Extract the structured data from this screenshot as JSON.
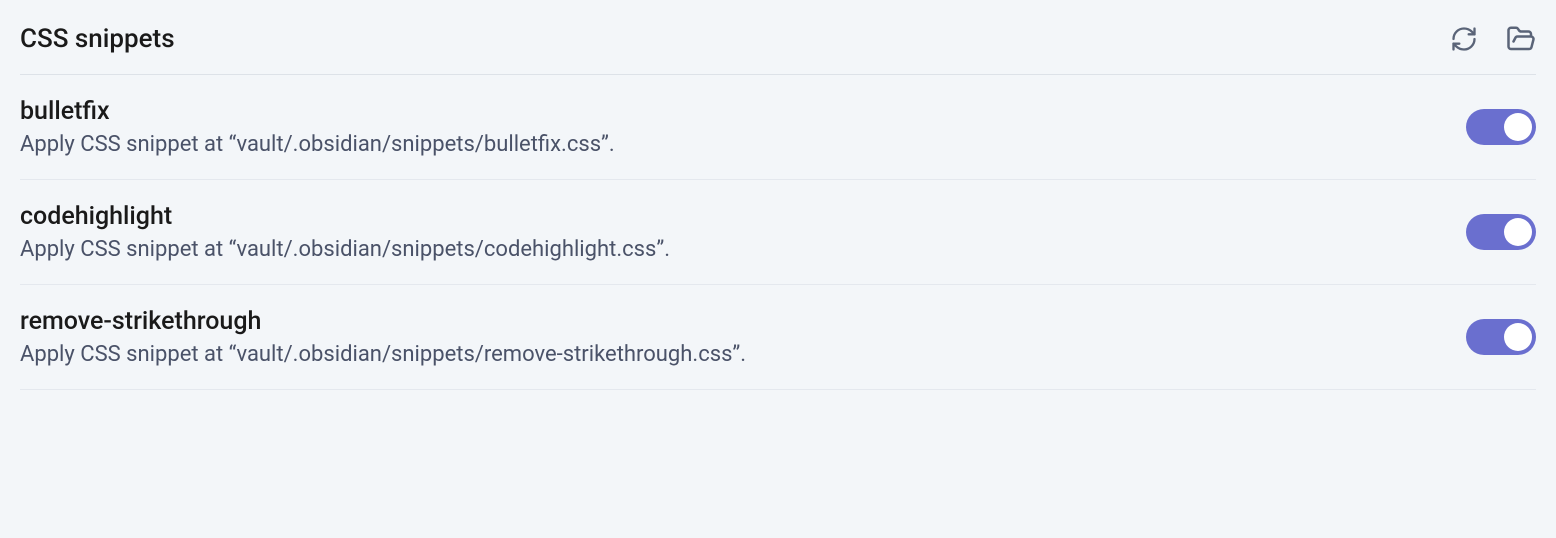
{
  "section": {
    "title": "CSS snippets"
  },
  "snippets": [
    {
      "name": "bulletfix",
      "description": "Apply CSS snippet at “vault/.obsidian/snippets/bulletfix.css”.",
      "enabled": true
    },
    {
      "name": "codehighlight",
      "description": "Apply CSS snippet at “vault/.obsidian/snippets/codehighlight.css”.",
      "enabled": true
    },
    {
      "name": "remove-strikethrough",
      "description": "Apply CSS snippet at “vault/.obsidian/snippets/remove-strikethrough.css”.",
      "enabled": true
    }
  ]
}
